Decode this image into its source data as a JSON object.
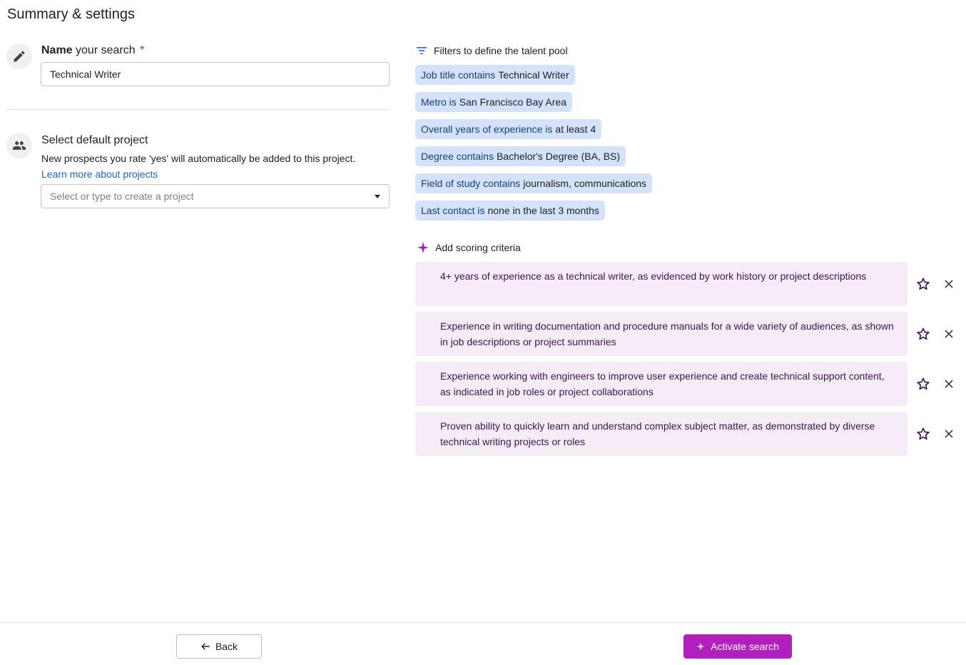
{
  "page": {
    "title": "Summary & settings"
  },
  "name_section": {
    "label_bold": "Name",
    "label_rest": " your search",
    "required_mark": "*",
    "input_value": "Technical Writer"
  },
  "project_section": {
    "title": "Select default project",
    "description": "New prospects you rate 'yes' will automatically be added to this project.",
    "learn_more_link": "Learn more about projects",
    "select_placeholder": "Select or type to create a project"
  },
  "filters": {
    "header": "Filters to define the talent pool",
    "items": [
      {
        "keyword": "Job title contains",
        "value": "Technical Writer"
      },
      {
        "keyword": "Metro is",
        "value": "San Francisco Bay Area"
      },
      {
        "keyword": "Overall years of experience is",
        "value": "at least 4"
      },
      {
        "keyword": "Degree contains",
        "value": "Bachelor's Degree (BA, BS)"
      },
      {
        "keyword": "Field of study contains",
        "value": "journalism, communications"
      },
      {
        "keyword": "Last contact is",
        "value": "none in the last 3 months"
      }
    ]
  },
  "scoring": {
    "header": "Add scoring criteria",
    "items": [
      {
        "text": "4+ years of experience as a technical writer, as evidenced by work history or project descriptions"
      },
      {
        "text": "Experience in writing documentation and procedure manuals for a wide variety of audiences, as shown in job descriptions or project summaries"
      },
      {
        "text": "Experience working with engineers to improve user experience and create technical support content, as indicated in job roles or project collaborations"
      },
      {
        "text": "Proven ability to quickly learn and understand complex subject matter, as demonstrated by diverse technical writing projects or roles"
      }
    ]
  },
  "footer": {
    "back_label": "Back",
    "activate_label": "Activate search"
  },
  "colors": {
    "accent": "#b21fbe",
    "link": "#1a66d1",
    "filter_chip": "#d4e3fb",
    "criterion_bg": "#f5ecf8"
  },
  "icons": {
    "name_section": "pencil-icon",
    "project_section": "people-icon",
    "filters": "filter-icon",
    "scoring": "sparkle-icon",
    "criterion_star": "star-outline-icon",
    "criterion_remove": "close-icon",
    "back": "arrow-left-icon",
    "activate": "sparkle-icon"
  }
}
